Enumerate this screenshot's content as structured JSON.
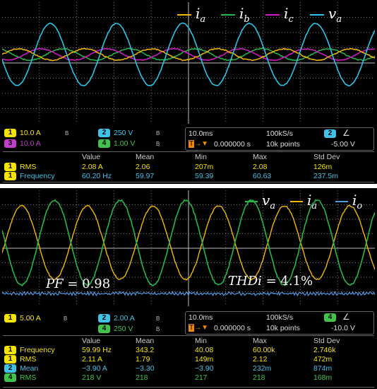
{
  "top": {
    "legend": [
      {
        "sym": "i",
        "sub": "a",
        "color": "#f2b800"
      },
      {
        "sym": "i",
        "sub": "b",
        "color": "#22b84a"
      },
      {
        "sym": "i",
        "sub": "c",
        "color": "#d419c8"
      },
      {
        "sym": "v",
        "sub": "a",
        "color": "#29c4e8"
      }
    ],
    "channels": [
      {
        "num": "1",
        "scale": "10.0 A",
        "color": "#f5e400"
      },
      {
        "num": "3",
        "scale": "10.0 A",
        "color": "#c03ec8"
      },
      {
        "num": "2",
        "scale": "250 V",
        "color": "#3fc2e8"
      },
      {
        "num": "4",
        "scale": "1.00 V",
        "color": "#41c24a"
      }
    ],
    "time": {
      "div": "10.0ms",
      "rate": "100kS/s",
      "points": "10k points",
      "offset": "0.000000 s",
      "trig_ch": "2",
      "trig_level": "-5.00 V",
      "trig_symbol": "∠"
    },
    "meas_headers": [
      "Value",
      "Mean",
      "Min",
      "Max",
      "Std Dev"
    ],
    "meas_rows": [
      {
        "ch": "1",
        "color": "#f5e400",
        "name": "RMS",
        "values": [
          "2.08 A",
          "2.06",
          "207m",
          "2.08",
          "126m"
        ]
      },
      {
        "ch": "1",
        "color": "#f5e400",
        "name": "Frequency",
        "values": [
          "60.20 Hz",
          "59.97",
          "59.39",
          "60.63",
          "237.5m"
        ]
      }
    ]
  },
  "bottom": {
    "legend": [
      {
        "sym": "v",
        "sub": "a",
        "color": "#22b84a"
      },
      {
        "sym": "i",
        "sub": "a",
        "color": "#f2b800"
      },
      {
        "sym": "i",
        "sub": "o",
        "color": "#4f9be6"
      }
    ],
    "annotations": {
      "pf": {
        "lhs": "PF",
        "rhs": " = 0.98"
      },
      "thd": {
        "lhs": "THDi",
        "rhs": " = 4.1%"
      }
    },
    "channels": [
      {
        "num": "1",
        "scale": "5.00 A",
        "color": "#f5e400"
      },
      {
        "num": "2",
        "scale": "2.00 A",
        "color": "#3fc2e8"
      },
      {
        "num": "4",
        "scale": "250 V",
        "color": "#41c24a"
      }
    ],
    "time": {
      "div": "10.0ms",
      "rate": "100kS/s",
      "points": "10k points",
      "offset": "0.000000 s",
      "trig_ch": "4",
      "trig_level": "-10.0 V",
      "trig_symbol": "∠"
    },
    "meas_headers": [
      "Value",
      "Mean",
      "Min",
      "Max",
      "Std Dev"
    ],
    "meas_rows": [
      {
        "ch": "1",
        "color": "#f5e400",
        "name": "Frequency",
        "values": [
          "59.99 Hz",
          "343.2",
          "40.08",
          "60.00k",
          "2.746k"
        ]
      },
      {
        "ch": "1",
        "color": "#f5e400",
        "name": "RMS",
        "values": [
          "2.11 A",
          "1.79",
          "149m",
          "2.12",
          "472m"
        ]
      },
      {
        "ch": "2",
        "color": "#3fc2e8",
        "name": "Mean",
        "values": [
          "−3.90 A",
          "−3.30",
          "−3.90",
          "232m",
          "874m"
        ]
      },
      {
        "ch": "4",
        "color": "#41c24a",
        "name": "RMS",
        "values": [
          "218 V",
          "218",
          "217",
          "218",
          "168m"
        ]
      }
    ]
  }
}
